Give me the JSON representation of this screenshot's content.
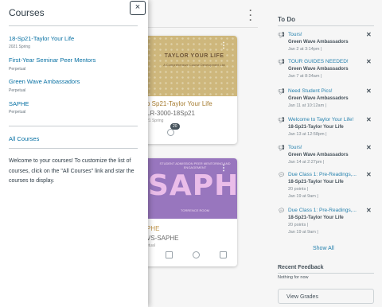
{
  "dashboard": {
    "cards": [
      {
        "hero_title": "TAYLOR YOUR LIFE",
        "hero_subtitle": "A Comprehensive Course Development List",
        "name": "p Sp21-Taylor Your Life",
        "code": "LR-3000-18Sp21",
        "term": "21 Spring",
        "badge": "20",
        "hero_color": "#c8ae6a"
      },
      {
        "hero_title": "SAPHE",
        "hero_top": "STUDENT ADMISSION PEER MENTORING AND ENGAGEMENT",
        "hero_bottom": "TORRENCE ROOM",
        "name": "PHE",
        "code": "VS-SAPHE",
        "term": "etual",
        "hero_color": "#8a64b6"
      }
    ]
  },
  "todo": {
    "title": "To Do",
    "items": [
      {
        "icon": "announcement-icon",
        "title": "Tours!",
        "course": "Green Wave Ambassadors",
        "meta": "Jan 2 at 3:14pm  |",
        "meta2": ""
      },
      {
        "icon": "announcement-icon",
        "title": "TOUR GUIDES NEEDED!",
        "course": "Green Wave Ambassadors",
        "meta": "Jan 7 at 8:34am  |",
        "meta2": ""
      },
      {
        "icon": "announcement-icon",
        "title": "Need Student Pics!",
        "course": "Green Wave Ambassadors",
        "meta": "Jan 11 at 10:12am  |",
        "meta2": ""
      },
      {
        "icon": "announcement-icon",
        "title": "Welcome to Taylor Your Life!",
        "course": "18-Sp21-Taylor Your Life",
        "meta": "Jan 13 at 12:58pm  |",
        "meta2": ""
      },
      {
        "icon": "announcement-icon",
        "title": "Tours!",
        "course": "Green Wave Ambassadors",
        "meta": "Jan 14 at 2:27pm  |",
        "meta2": ""
      },
      {
        "icon": "discussion-icon",
        "title": "Due Class 1: Pre-Readings,...",
        "course": "18-Sp21-Taylor Your Life",
        "meta": "20 points  |",
        "meta2": "Jan 19 at 9am  |"
      },
      {
        "icon": "discussion-icon",
        "title": "Due Class 1: Pre-Readings,...",
        "course": "18-Sp21-Taylor Your Life",
        "meta": "20 points  |",
        "meta2": "Jan 19 at 9am  |"
      }
    ],
    "show_all": "Show All",
    "recent_feedback_title": "Recent Feedback",
    "recent_feedback_text": "Nothing for now",
    "view_grades": "View Grades"
  },
  "tray": {
    "title": "Courses",
    "close": "×",
    "courses": [
      {
        "name": "18-Sp21-Taylor Your Life",
        "term": "2021 Spring"
      },
      {
        "name": "First-Year Seminar Peer Mentors",
        "term": "Perpetual"
      },
      {
        "name": "Green Wave Ambassadors",
        "term": "Perpetual"
      },
      {
        "name": "SAPHE",
        "term": "Perpetual"
      }
    ],
    "all_courses": "All Courses",
    "welcome": "Welcome to your courses! To customize the list of courses, click on the \"All Courses\" link and star the courses to display."
  }
}
